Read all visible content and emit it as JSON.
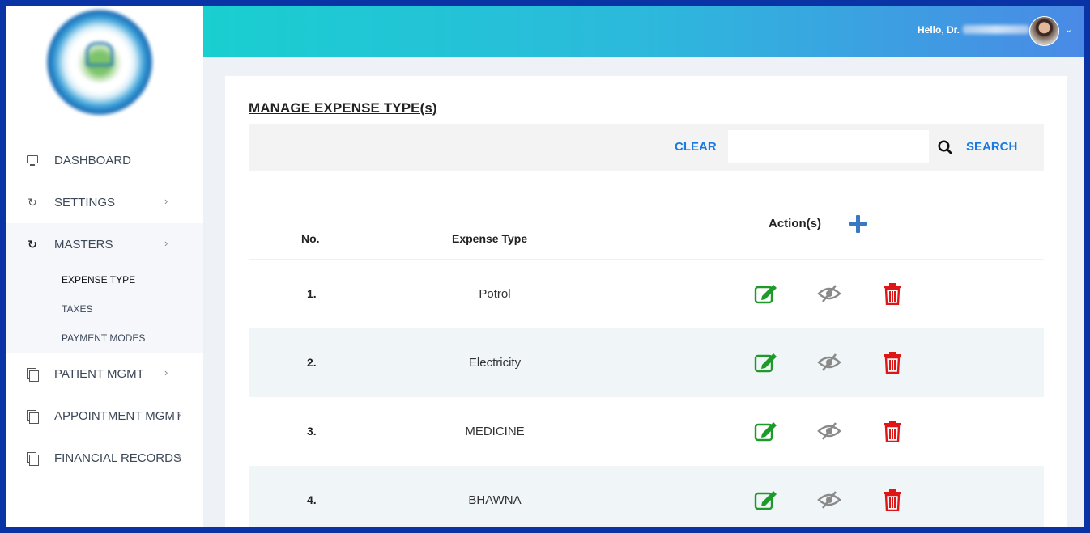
{
  "header": {
    "greeting": "Hello, Dr."
  },
  "sidebar": {
    "items": [
      {
        "label": "DASHBOARD"
      },
      {
        "label": "SETTINGS"
      },
      {
        "label": "MASTERS"
      },
      {
        "label": "PATIENT MGMT"
      },
      {
        "label": "APPOINTMENT MGMT"
      },
      {
        "label": "FINANCIAL RECORDS"
      }
    ],
    "masters_sub": [
      {
        "label": "EXPENSE TYPE"
      },
      {
        "label": "TAXES"
      },
      {
        "label": "PAYMENT MODES"
      }
    ]
  },
  "main": {
    "title": "MANAGE EXPENSE TYPE(s)",
    "clear_label": "CLEAR",
    "search_label": "SEARCH",
    "search_value": "",
    "columns": {
      "no": "No.",
      "type": "Expense Type",
      "actions": "Action(s)"
    },
    "rows": [
      {
        "no": "1.",
        "type": "Potrol"
      },
      {
        "no": "2.",
        "type": "Electricity"
      },
      {
        "no": "3.",
        "type": "MEDICINE"
      },
      {
        "no": "4.",
        "type": "BHAWNA"
      }
    ]
  },
  "colors": {
    "accent": "#1a7ae0",
    "edit": "#1e9a2a",
    "view": "#8a8a8a",
    "delete": "#e01616",
    "add": "#3a78c4",
    "header_from": "#19cfd0",
    "header_to": "#4a8ae6"
  },
  "icons": {
    "edit": "edit-icon",
    "view": "eye-slash-icon",
    "delete": "trash-icon",
    "add": "plus-icon",
    "search": "search-icon"
  }
}
